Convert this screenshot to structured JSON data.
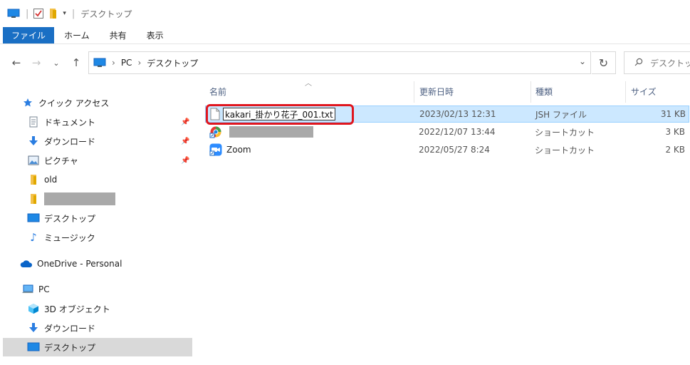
{
  "window": {
    "title": "デスクトップ"
  },
  "ribbon": {
    "tabs": [
      "ファイル",
      "ホーム",
      "共有",
      "表示"
    ]
  },
  "address": {
    "crumbs": [
      "PC",
      "デスクトップ"
    ]
  },
  "search": {
    "placeholder": "デスクトップの検索"
  },
  "nav": {
    "quick_access": "クイック アクセス",
    "documents": "ドキュメント",
    "downloads": "ダウンロード",
    "pictures": "ピクチャ",
    "old": "old",
    "desktop": "デスクトップ",
    "music": "ミュージック",
    "onedrive": "OneDrive - Personal",
    "pc": "PC",
    "objects3d": "3D オブジェクト",
    "downloads2": "ダウンロード",
    "desktop2": "デスクトップ"
  },
  "columns": {
    "name": "名前",
    "date": "更新日時",
    "type": "種類",
    "size": "サイズ"
  },
  "files": [
    {
      "name": "kakari_掛かり花子_001.txt",
      "date": "2023/02/13 12:31",
      "type": "JSH ファイル",
      "size": "31 KB"
    },
    {
      "name": "",
      "date": "2022/12/07 13:44",
      "type": "ショートカット",
      "size": "3 KB"
    },
    {
      "name": "Zoom",
      "date": "2022/05/27 8:24",
      "type": "ショートカット",
      "size": "2 KB"
    }
  ],
  "colors": {
    "accent": "#1a6fc4",
    "selection": "#cce8ff",
    "highlight": "#e0161e"
  }
}
